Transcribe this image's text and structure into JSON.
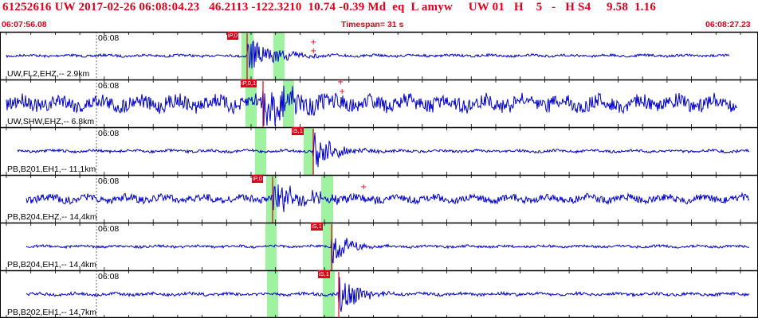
{
  "header": {
    "event_id": "61252616",
    "network": "UW",
    "origin_time": "2017-02-26 06:08:04.23",
    "latitude": "46.2113",
    "longitude": "-122.3210",
    "depth": "10.74",
    "magnitude": "-0.39 Md",
    "event_type": "eq",
    "flags": "L amyw",
    "solution": "UW 01",
    "quality": "H",
    "num": "5",
    "dash": "-",
    "status": "H S4",
    "val1": "9.58",
    "val2": "1.16"
  },
  "window": {
    "start_time": "06:07:56.08",
    "timespan_label": "Timespan=  31 s",
    "end_time": "06:08:27.23"
  },
  "colors": {
    "header_text": "#e0001b",
    "trace": "#0000cc",
    "pick_bg": "#e0001b",
    "phase_window": "#9ff29f",
    "grid": "#000000"
  },
  "traces": [
    {
      "label": "UW,FL2,EHZ,-- 2.9km",
      "time_tick": "06:08",
      "pick": "iP,0"
    },
    {
      "label": "UW,SHW,EHZ,-- 6.8km",
      "time_tick": "06:08",
      "pick": "iP,0,1"
    },
    {
      "label": "PB,B201,EH1,-- 11.1km",
      "time_tick": "06:08",
      "pick": "iS,1"
    },
    {
      "label": "PB,B204,EHZ,-- 14.4km",
      "time_tick": "06:08",
      "pick": "iP,0"
    },
    {
      "label": "PB,B204,EH1,-- 14.4km",
      "time_tick": "06:08",
      "pick": "iS,1"
    },
    {
      "label": "PB,B202,EH1,-- 14.7km",
      "time_tick": "06:08",
      "pick": "iS,1"
    }
  ]
}
